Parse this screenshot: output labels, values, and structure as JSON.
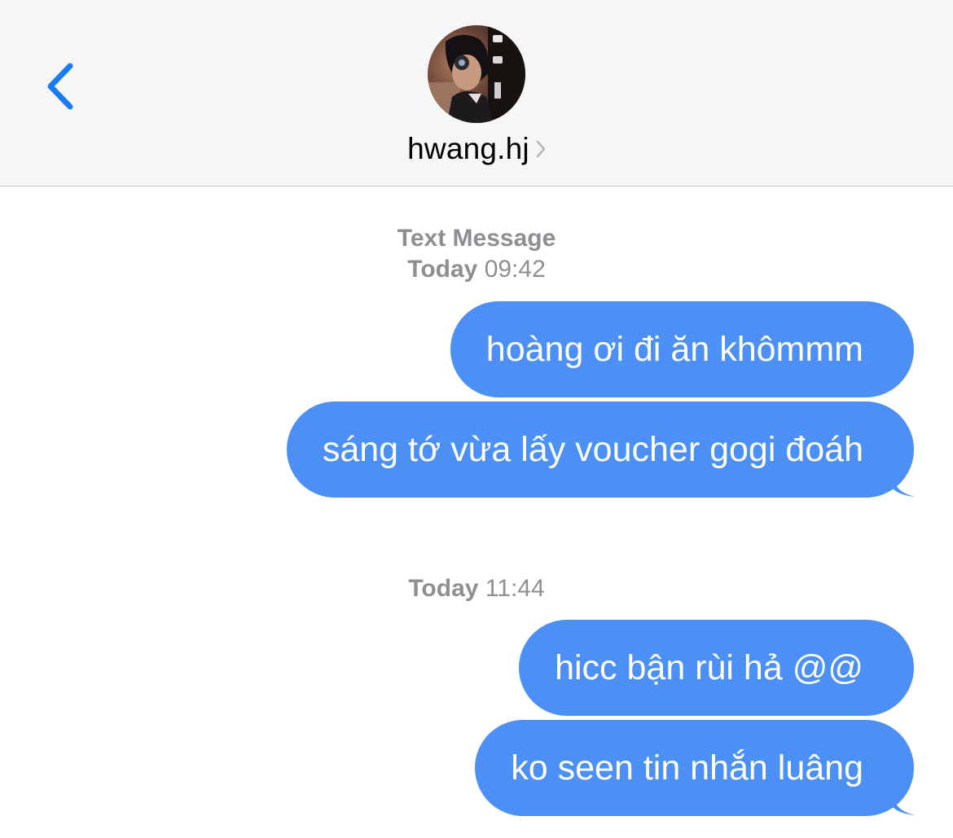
{
  "header": {
    "contact_name": "hwang.hj"
  },
  "messages": {
    "service_label": "Text Message",
    "group1": {
      "day": "Today",
      "time": "09:42",
      "bubbles": [
        "hoàng ơi đi ăn khômmm",
        "sáng tớ vừa lấy voucher gogi đoáh"
      ]
    },
    "group2": {
      "day": "Today",
      "time": "11:44",
      "bubbles": [
        "hicc bận rùi hả @@",
        "ko seen tin nhắn luâng"
      ]
    }
  },
  "colors": {
    "bubble": "#4c90f5",
    "accent": "#1a7cf5",
    "header_bg": "#f6f6f6",
    "meta_text": "#8e8e93"
  }
}
